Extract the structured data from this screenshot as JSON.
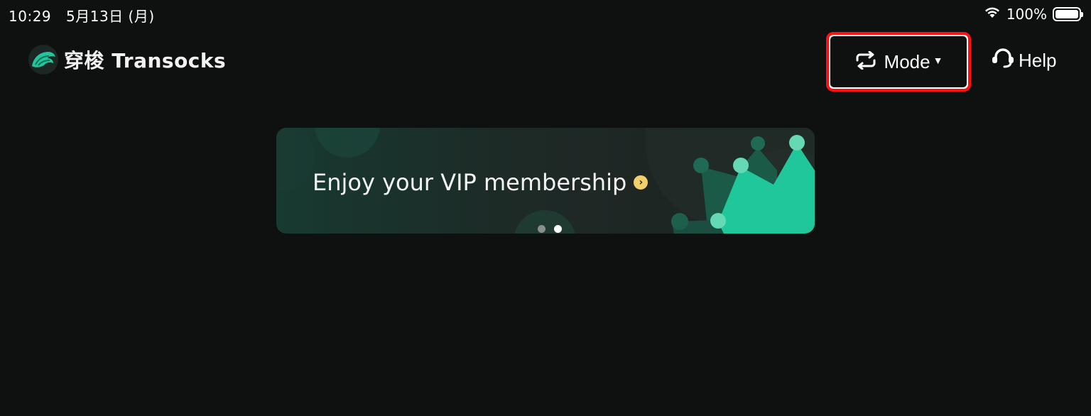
{
  "status_bar": {
    "time": "10:29",
    "date": "5月13日 (月)",
    "battery": "100%"
  },
  "header": {
    "brand": "穿梭 Transocks",
    "mode_label": "Mode",
    "help_label": "Help"
  },
  "banner": {
    "title": "Enjoy your VIP membership",
    "active_slide": 2,
    "slide_count": 2
  },
  "colors": {
    "background": "#0f1111",
    "accent": "#1fc79a",
    "highlight_border": "#ff1010",
    "arrow_badge": "#f3cf6c"
  },
  "icons": {
    "brand": "transocks-logo",
    "mode": "swap-arrows-icon",
    "mode_dropdown": "caret-down-icon",
    "help": "headset-icon",
    "wifi": "wifi-icon",
    "battery": "battery-icon",
    "banner_arrow": "chevron-right-icon"
  }
}
